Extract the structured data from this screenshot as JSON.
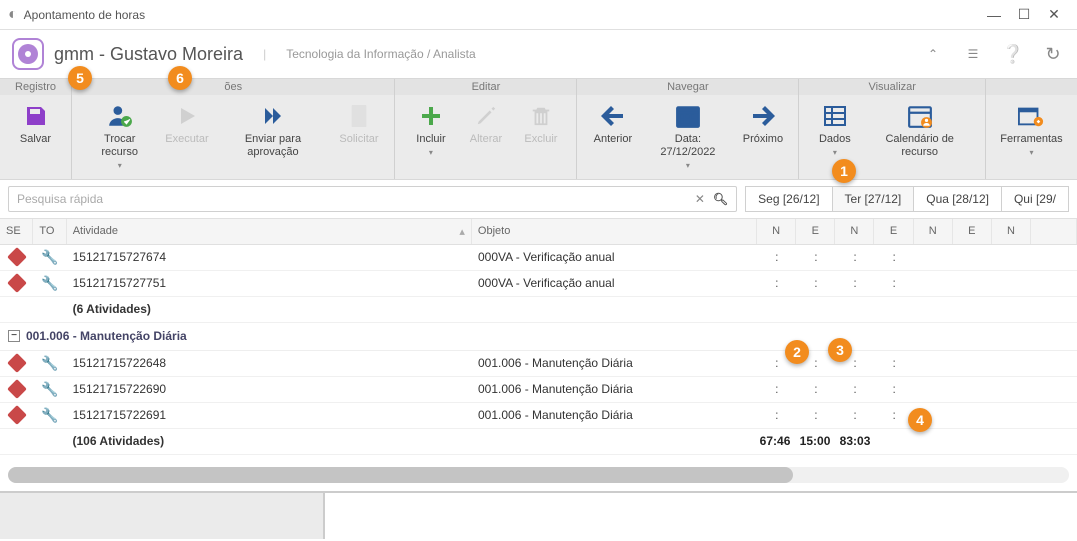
{
  "window": {
    "title": "Apontamento de horas"
  },
  "header": {
    "prefix": "gmm",
    "name": "Gustavo Moreira",
    "role": "Tecnologia da Informação / Analista"
  },
  "ribbon": {
    "groups": {
      "registro": {
        "label": "Registro",
        "save": "Salvar"
      },
      "acoes": {
        "label": "ões",
        "trocar": "Trocar recurso",
        "executar": "Executar",
        "enviar": "Enviar para aprovação",
        "solicitar": "Solicitar"
      },
      "editar": {
        "label": "Editar",
        "incluir": "Incluir",
        "alterar": "Alterar",
        "excluir": "Excluir"
      },
      "navegar": {
        "label": "Navegar",
        "anterior": "Anterior",
        "data": "Data: 27/12/2022",
        "proximo": "Próximo"
      },
      "visualizar": {
        "label": "Visualizar",
        "dados": "Dados",
        "calendario": "Calendário de recurso"
      },
      "ferramentas": {
        "label": "Ferramentas"
      }
    }
  },
  "search": {
    "placeholder": "Pesquisa rápida"
  },
  "day_tabs": [
    {
      "label": "Seg [26/12]"
    },
    {
      "label": "Ter [27/12]"
    },
    {
      "label": "Qua [28/12]"
    },
    {
      "label": "Qui [29/"
    }
  ],
  "columns": {
    "se": "SE",
    "to": "TO",
    "atividade": "Atividade",
    "objeto": "Objeto",
    "n": "N",
    "e": "E"
  },
  "rows": [
    {
      "atividade": "15121715727674",
      "objeto": "000VA - Verificação anual"
    },
    {
      "atividade": "15121715727751",
      "objeto": "000VA - Verificação anual"
    }
  ],
  "group1_summary": "(6 Atividades)",
  "group2": {
    "title": "001.006 - Manutenção Diária"
  },
  "rows2": [
    {
      "atividade": "15121715722648",
      "objeto": "001.006 - Manutenção Diária"
    },
    {
      "atividade": "15121715722690",
      "objeto": "001.006 - Manutenção Diária"
    },
    {
      "atividade": "15121715722691",
      "objeto": "001.006 - Manutenção Diária"
    }
  ],
  "group2_summary": "(106 Atividades)",
  "totals": {
    "seg_n": "67:46",
    "seg_e": "15:00",
    "ter_n": "83:03"
  },
  "markers": {
    "m1": "1",
    "m2": "2",
    "m3": "3",
    "m4": "4",
    "m5": "5",
    "m6": "6"
  },
  "colon": ":"
}
